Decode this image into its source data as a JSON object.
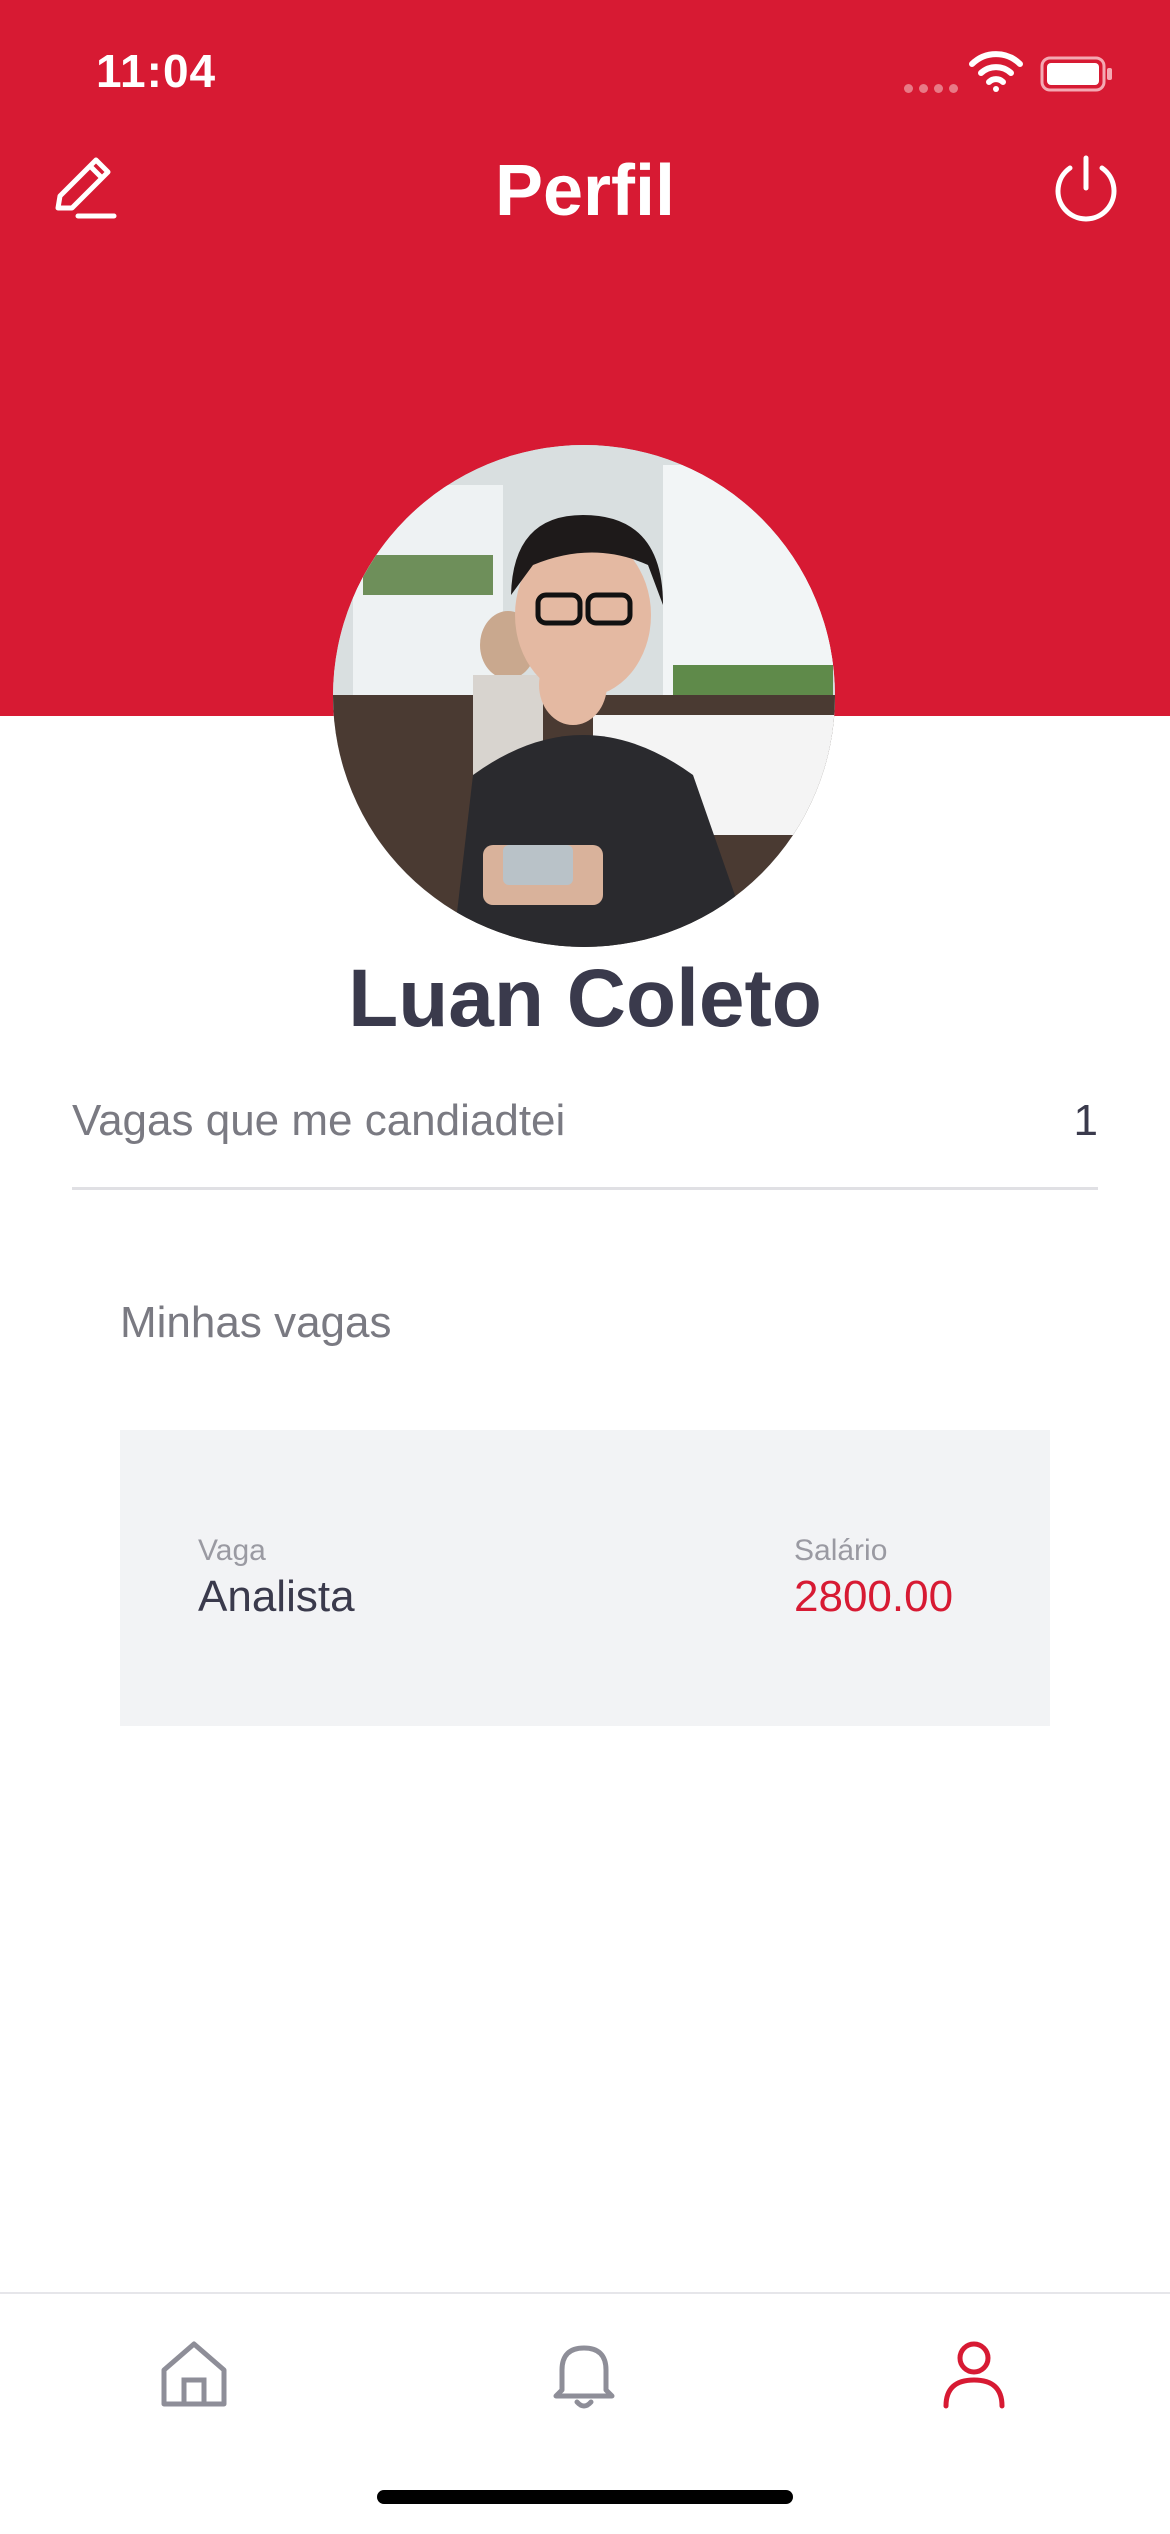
{
  "status_bar": {
    "time": "11:04"
  },
  "header": {
    "title": "Perfil"
  },
  "profile": {
    "name": "Luan Coleto",
    "stats": {
      "label": "Vagas que me candiadtei",
      "value": "1"
    }
  },
  "my_jobs": {
    "section_title": "Minhas vagas",
    "items": [
      {
        "job_label": "Vaga",
        "job_value": "Analista",
        "salary_label": "Salário",
        "salary_value": "2800.00"
      }
    ]
  },
  "nav": {
    "items": [
      "home-icon",
      "bell-icon",
      "user-icon"
    ],
    "active": "user-icon"
  },
  "colors": {
    "brand": "#d71a33",
    "text_dark": "#3a3a4c",
    "text_muted": "#7a7a82",
    "card_bg": "#f2f3f5",
    "nav_inactive": "#8e8e98"
  }
}
